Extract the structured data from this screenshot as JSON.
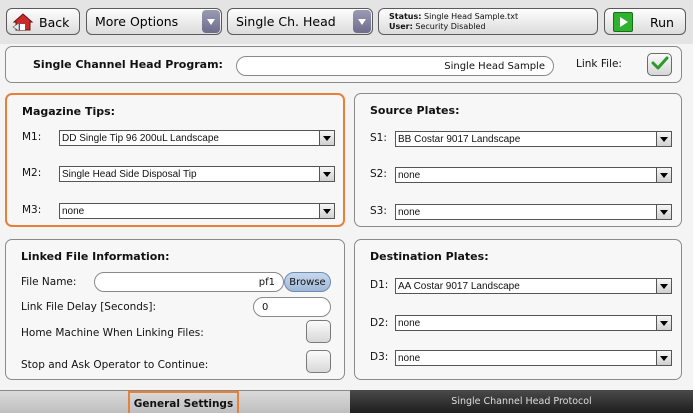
{
  "toolbar": {
    "back_label": "Back",
    "options_label": "More Options",
    "head_label": "Single Ch. Head",
    "status_label": "Status:",
    "status_value": "Single Head Sample.txt",
    "user_label": "User:",
    "user_value": "Security Disabled",
    "run_label": "Run"
  },
  "program": {
    "label": "Single Channel Head Program:",
    "value": "Single Head Sample",
    "link_file_label": "Link File:",
    "link_file_checked": true
  },
  "magazine": {
    "title": "Magazine Tips:",
    "rows": [
      {
        "label": "M1:",
        "value": "DD Single Tip 96 200uL Landscape"
      },
      {
        "label": "M2:",
        "value": "Single Head Side Disposal Tip"
      },
      {
        "label": "M3:",
        "value": "none"
      }
    ]
  },
  "source": {
    "title": "Source Plates:",
    "rows": [
      {
        "label": "S1:",
        "value": "BB Costar 9017 Landscape"
      },
      {
        "label": "S2:",
        "value": "none"
      },
      {
        "label": "S3:",
        "value": "none"
      }
    ]
  },
  "linked": {
    "title": "Linked File Information:",
    "file_name_label": "File Name:",
    "file_name_value": "pf1",
    "browse_label": "Browse",
    "delay_label": "Link File Delay [Seconds]:",
    "delay_value": "0",
    "home_label": "Home Machine When Linking Files:",
    "stop_label": "Stop and Ask Operator to Continue:"
  },
  "destination": {
    "title": "Destination Plates:",
    "rows": [
      {
        "label": "D1:",
        "value": "AA Costar 9017 Landscape"
      },
      {
        "label": "D2:",
        "value": "none"
      },
      {
        "label": "D3:",
        "value": "none"
      }
    ]
  },
  "tabs": {
    "general": "General Settings",
    "protocol": "Single Channel Head Protocol"
  },
  "colors": {
    "highlight": "#e8803a",
    "run_green": "#2fb32f",
    "check_green": "#2a9a2a",
    "back_red": "#c92b2b"
  }
}
